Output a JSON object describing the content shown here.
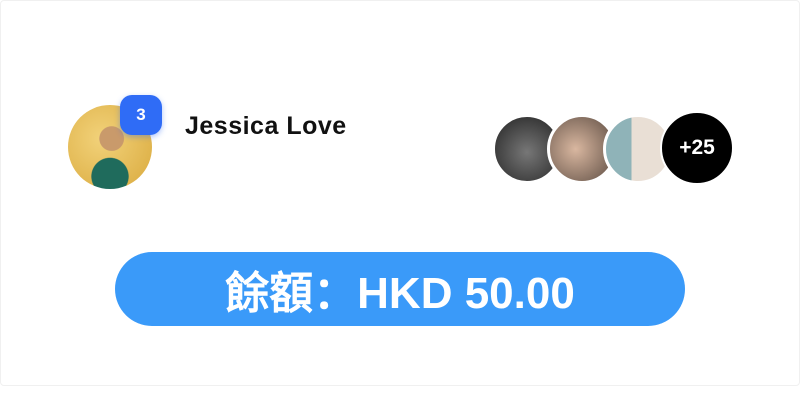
{
  "user": {
    "name": "Jessica Love",
    "notification_count": "3"
  },
  "members": {
    "extra_count": "+25"
  },
  "balance": {
    "label": "餘額：HKD 50.00"
  },
  "colors": {
    "badge": "#2f6cf6",
    "pill": "#3a9af9"
  }
}
